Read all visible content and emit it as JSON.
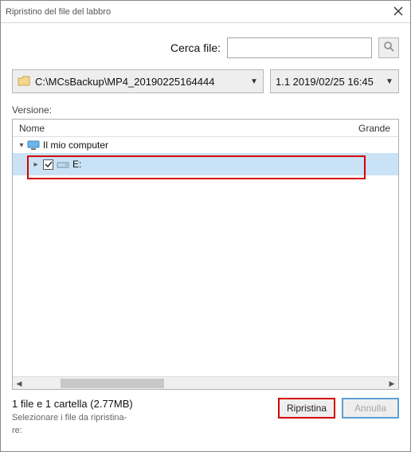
{
  "window": {
    "title": "Ripristino del file del labbro"
  },
  "search": {
    "label": "Cerca file:",
    "value": "",
    "placeholder": ""
  },
  "path_dropdown": {
    "text": "C:\\MCsBackup\\MP4_20190225164444"
  },
  "version_dropdown": {
    "text": "1.1  2019/02/25 16:45"
  },
  "version_label": "Versione:",
  "tree": {
    "columns": {
      "name": "Nome",
      "size": "Grande"
    },
    "root": {
      "label": "Il mio computer"
    },
    "drive": {
      "label": "E:",
      "checked": true
    }
  },
  "status": {
    "summary": "1 file e 1 cartella (2.77MB)",
    "hint1": "Selezionare i file da ripristina-",
    "hint2": "re:"
  },
  "buttons": {
    "restore": "Ripristina",
    "cancel": "Annulla"
  }
}
